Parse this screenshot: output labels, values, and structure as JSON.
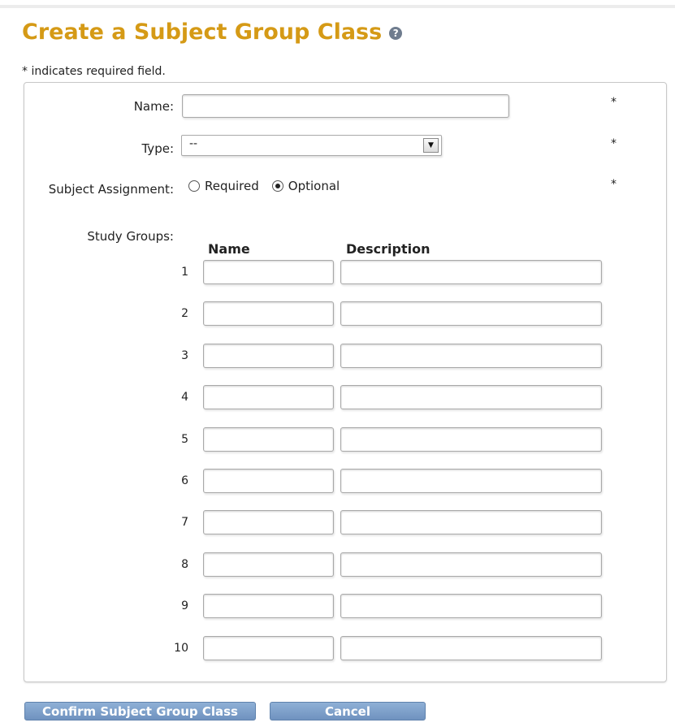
{
  "page": {
    "title": "Create a Subject Group Class",
    "help_icon": "question-circle-icon",
    "required_note": "* indicates required field."
  },
  "form": {
    "name": {
      "label": "Name:",
      "value": "",
      "required_marker": "*"
    },
    "type": {
      "label": "Type:",
      "selected": "--",
      "required_marker": "*"
    },
    "subject_assignment": {
      "label": "Subject Assignment:",
      "options": [
        {
          "label": "Required",
          "checked": false
        },
        {
          "label": "Optional",
          "checked": true
        }
      ],
      "required_marker": "*"
    },
    "study_groups": {
      "label": "Study Groups:",
      "columns": {
        "name": "Name",
        "description": "Description"
      },
      "rows": [
        {
          "num": "1",
          "name": "",
          "description": ""
        },
        {
          "num": "2",
          "name": "",
          "description": ""
        },
        {
          "num": "3",
          "name": "",
          "description": ""
        },
        {
          "num": "4",
          "name": "",
          "description": ""
        },
        {
          "num": "5",
          "name": "",
          "description": ""
        },
        {
          "num": "6",
          "name": "",
          "description": ""
        },
        {
          "num": "7",
          "name": "",
          "description": ""
        },
        {
          "num": "8",
          "name": "",
          "description": ""
        },
        {
          "num": "9",
          "name": "",
          "description": ""
        },
        {
          "num": "10",
          "name": "",
          "description": ""
        }
      ]
    }
  },
  "actions": {
    "confirm_label": "Confirm Subject Group Class",
    "cancel_label": "Cancel"
  },
  "colors": {
    "title": "#d59a16",
    "button": "#7a9cc8"
  }
}
